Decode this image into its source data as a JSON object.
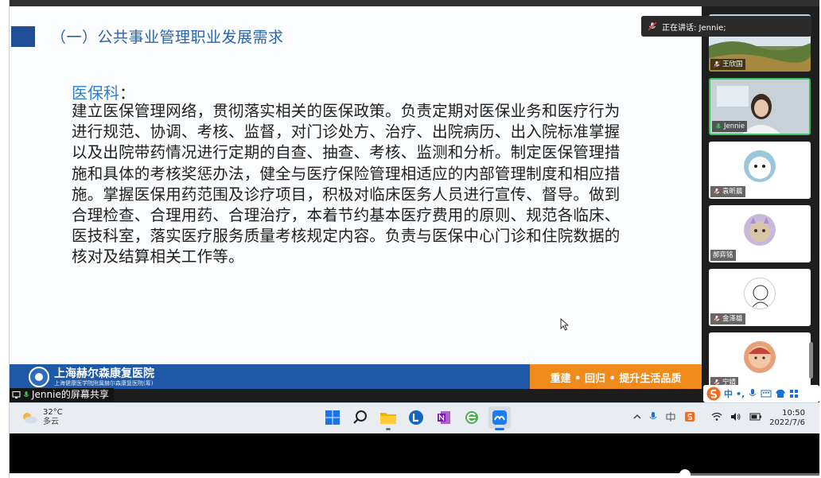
{
  "slide": {
    "title": "（一）公共事业管理职业发展需求",
    "dept_heading": "医保科",
    "dept_colon": "：",
    "body": "建立医保管理网络，贯彻落实相关的医保政策。负责定期对医保业务和医疗行为进行规范、协调、考核、监督，对门诊处方、治疗、出院病历、出入院标准掌握以及出院带药情况进行定期的自查、抽查、考核、监测和分析。制定医保管理措施和具体的考核奖惩办法，健全与医疗保险管理相适应的内部管理制度和相应措施。掌握医保用药范围及诊疗项目，积极对临床医务人员进行宣传、督导。做到合理检查、合理用药、合理治疗，本着节约基本医疗费用的原则、规范各临床、医技科室，落实医疗服务质量考核规定内容。负责与医保中心门诊和住院数据的核对及结算相关工作等。",
    "hospital_name": "上海赫尔森康复医院",
    "hospital_sub": "上海健康医学院附属赫尔森康复医院(筹)",
    "slogan": "重建 • 回归 • 提升生活品质"
  },
  "share_label": "Jennie的屏幕共享",
  "speaking": "正在讲话: Jennie;",
  "participants": [
    {
      "name": "王欣国"
    },
    {
      "name": "Jennie"
    },
    {
      "name": "袁昕晨"
    },
    {
      "name": "郝弈铭"
    },
    {
      "name": "金泽雄"
    },
    {
      "name": "宁婧"
    }
  ],
  "ime": {
    "lang": "中",
    "punct": "•,"
  },
  "taskbar": {
    "weather_temp": "32°C",
    "weather_desc": "多云",
    "time": "10:50",
    "date": "2022/7/6"
  },
  "colors": {
    "accent_blue": "#1f58a6",
    "slogan_orange": "#f08a1a",
    "speaking_green": "#3cbf5e"
  }
}
